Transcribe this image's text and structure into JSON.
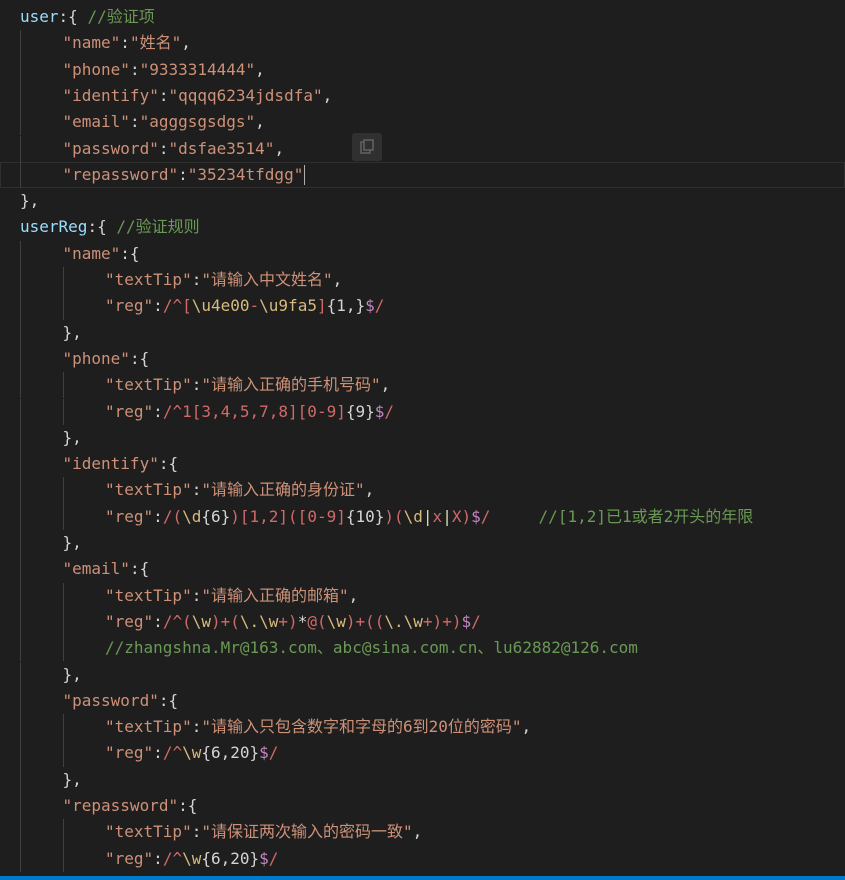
{
  "editor": {
    "lines": [
      {
        "indent": 0,
        "tokens": [
          [
            "var",
            "user"
          ],
          [
            "punc",
            ":{ "
          ],
          [
            "cmt",
            "//验证项"
          ]
        ]
      },
      {
        "indent": 1,
        "tokens": [
          [
            "key",
            "\"name\""
          ],
          [
            "punc",
            ":"
          ],
          [
            "str",
            "\"姓名\""
          ],
          [
            "punc",
            ","
          ]
        ]
      },
      {
        "indent": 1,
        "tokens": [
          [
            "key",
            "\"phone\""
          ],
          [
            "punc",
            ":"
          ],
          [
            "str",
            "\"9333314444\""
          ],
          [
            "punc",
            ","
          ]
        ]
      },
      {
        "indent": 1,
        "tokens": [
          [
            "key",
            "\"identify\""
          ],
          [
            "punc",
            ":"
          ],
          [
            "str",
            "\"qqqq6234jdsdfa\""
          ],
          [
            "punc",
            ","
          ]
        ]
      },
      {
        "indent": 1,
        "tokens": [
          [
            "key",
            "\"email\""
          ],
          [
            "punc",
            ":"
          ],
          [
            "str",
            "\"agggsgsdgs\""
          ],
          [
            "punc",
            ","
          ]
        ]
      },
      {
        "indent": 1,
        "tokens": [
          [
            "key",
            "\"password\""
          ],
          [
            "punc",
            ":"
          ],
          [
            "str",
            "\"dsfae3514\""
          ],
          [
            "punc",
            ","
          ]
        ]
      },
      {
        "indent": 1,
        "current": true,
        "caret": true,
        "tokens": [
          [
            "key",
            "\"repassword\""
          ],
          [
            "punc",
            ":"
          ],
          [
            "str",
            "\"35234tfdgg\""
          ]
        ]
      },
      {
        "indent": 0,
        "tokens": [
          [
            "punc",
            "},"
          ]
        ]
      },
      {
        "indent": 0,
        "tokens": [
          [
            "var",
            "userReg"
          ],
          [
            "punc",
            ":{ "
          ],
          [
            "cmt",
            "//验证规则"
          ]
        ]
      },
      {
        "indent": 1,
        "tokens": [
          [
            "key",
            "\"name\""
          ],
          [
            "punc",
            ":{"
          ]
        ]
      },
      {
        "indent": 2,
        "tokens": [
          [
            "key",
            "\"textTip\""
          ],
          [
            "punc",
            ":"
          ],
          [
            "str",
            "\"请输入中文姓名\""
          ],
          [
            "punc",
            ","
          ]
        ]
      },
      {
        "indent": 2,
        "tokens": [
          [
            "key",
            "\"reg\""
          ],
          [
            "punc",
            ":"
          ],
          [
            "re",
            "/^"
          ],
          [
            "re",
            "["
          ],
          [
            "esc",
            "\\u4e00"
          ],
          [
            "re",
            "-"
          ],
          [
            "esc",
            "\\u9fa5"
          ],
          [
            "re",
            "]"
          ],
          [
            "quant",
            "{1,}"
          ],
          [
            "anchor",
            "$"
          ],
          [
            "re",
            "/"
          ]
        ]
      },
      {
        "indent": 1,
        "tokens": [
          [
            "punc",
            "},"
          ]
        ]
      },
      {
        "indent": 1,
        "tokens": [
          [
            "key",
            "\"phone\""
          ],
          [
            "punc",
            ":{"
          ]
        ]
      },
      {
        "indent": 2,
        "tokens": [
          [
            "key",
            "\"textTip\""
          ],
          [
            "punc",
            ":"
          ],
          [
            "str",
            "\"请输入正确的手机号码\""
          ],
          [
            "punc",
            ","
          ]
        ]
      },
      {
        "indent": 2,
        "tokens": [
          [
            "key",
            "\"reg\""
          ],
          [
            "punc",
            ":"
          ],
          [
            "re",
            "/^1[3,4,5,7,8][0-9]"
          ],
          [
            "quant",
            "{9}"
          ],
          [
            "anchor",
            "$"
          ],
          [
            "re",
            "/"
          ]
        ]
      },
      {
        "indent": 1,
        "tokens": [
          [
            "punc",
            "},"
          ]
        ]
      },
      {
        "indent": 1,
        "tokens": [
          [
            "key",
            "\"identify\""
          ],
          [
            "punc",
            ":{"
          ]
        ]
      },
      {
        "indent": 2,
        "tokens": [
          [
            "key",
            "\"textTip\""
          ],
          [
            "punc",
            ":"
          ],
          [
            "str",
            "\"请输入正确的身份证\""
          ],
          [
            "punc",
            ","
          ]
        ]
      },
      {
        "indent": 2,
        "tokens": [
          [
            "key",
            "\"reg\""
          ],
          [
            "punc",
            ":"
          ],
          [
            "re",
            "/("
          ],
          [
            "esc",
            "\\d"
          ],
          [
            "quant",
            "{6}"
          ],
          [
            "re",
            ")[1,2](["
          ],
          [
            "re",
            "0-9]"
          ],
          [
            "quant",
            "{10}"
          ],
          [
            "re",
            ")("
          ],
          [
            "esc",
            "\\d"
          ],
          [
            "op",
            "|"
          ],
          [
            "re",
            "x"
          ],
          [
            "op",
            "|"
          ],
          [
            "re",
            "X)"
          ],
          [
            "anchor",
            "$"
          ],
          [
            "re",
            "/"
          ],
          [
            "punc",
            "     "
          ],
          [
            "cmt",
            "//[1,2]已1或者2开头的年限"
          ]
        ]
      },
      {
        "indent": 1,
        "tokens": [
          [
            "punc",
            "},"
          ]
        ]
      },
      {
        "indent": 1,
        "tokens": [
          [
            "key",
            "\"email\""
          ],
          [
            "punc",
            ":{"
          ]
        ]
      },
      {
        "indent": 2,
        "tokens": [
          [
            "key",
            "\"textTip\""
          ],
          [
            "punc",
            ":"
          ],
          [
            "str",
            "\"请输入正确的邮箱\""
          ],
          [
            "punc",
            ","
          ]
        ]
      },
      {
        "indent": 2,
        "tokens": [
          [
            "key",
            "\"reg\""
          ],
          [
            "punc",
            ":"
          ],
          [
            "re",
            "/^("
          ],
          [
            "esc",
            "\\w"
          ],
          [
            "re",
            ")+("
          ],
          [
            "esc",
            "\\.\\w"
          ],
          [
            "re",
            "+)"
          ],
          [
            "quant",
            "*"
          ],
          [
            "re",
            "@("
          ],
          [
            "esc",
            "\\w"
          ],
          [
            "re",
            ")+(("
          ],
          [
            "esc",
            "\\.\\w"
          ],
          [
            "re",
            "+)+)"
          ],
          [
            "anchor",
            "$"
          ],
          [
            "re",
            "/"
          ]
        ]
      },
      {
        "indent": 2,
        "tokens": [
          [
            "cmt",
            "//zhangshna.Mr@163.com、abc@sina.com.cn、lu62882@126.com"
          ]
        ]
      },
      {
        "indent": 1,
        "tokens": [
          [
            "punc",
            "},"
          ]
        ]
      },
      {
        "indent": 1,
        "tokens": [
          [
            "key",
            "\"password\""
          ],
          [
            "punc",
            ":{"
          ]
        ]
      },
      {
        "indent": 2,
        "tokens": [
          [
            "key",
            "\"textTip\""
          ],
          [
            "punc",
            ":"
          ],
          [
            "str",
            "\"请输入只包含数字和字母的6到20位的密码\""
          ],
          [
            "punc",
            ","
          ]
        ]
      },
      {
        "indent": 2,
        "tokens": [
          [
            "key",
            "\"reg\""
          ],
          [
            "punc",
            ":"
          ],
          [
            "re",
            "/^"
          ],
          [
            "esc",
            "\\w"
          ],
          [
            "quant",
            "{6,20}"
          ],
          [
            "anchor",
            "$"
          ],
          [
            "re",
            "/"
          ]
        ]
      },
      {
        "indent": 1,
        "tokens": [
          [
            "punc",
            "},"
          ]
        ]
      },
      {
        "indent": 1,
        "tokens": [
          [
            "key",
            "\"repassword\""
          ],
          [
            "punc",
            ":{"
          ]
        ]
      },
      {
        "indent": 2,
        "tokens": [
          [
            "key",
            "\"textTip\""
          ],
          [
            "punc",
            ":"
          ],
          [
            "str",
            "\"请保证两次输入的密码一致\""
          ],
          [
            "punc",
            ","
          ]
        ]
      },
      {
        "indent": 2,
        "tokens": [
          [
            "key",
            "\"reg\""
          ],
          [
            "punc",
            ":"
          ],
          [
            "re",
            "/^"
          ],
          [
            "esc",
            "\\w"
          ],
          [
            "quant",
            "{6,20}"
          ],
          [
            "anchor",
            "$"
          ],
          [
            "re",
            "/"
          ]
        ]
      }
    ]
  },
  "colors": {
    "background": "#1e1e1e",
    "statusbar": "#007acc"
  }
}
